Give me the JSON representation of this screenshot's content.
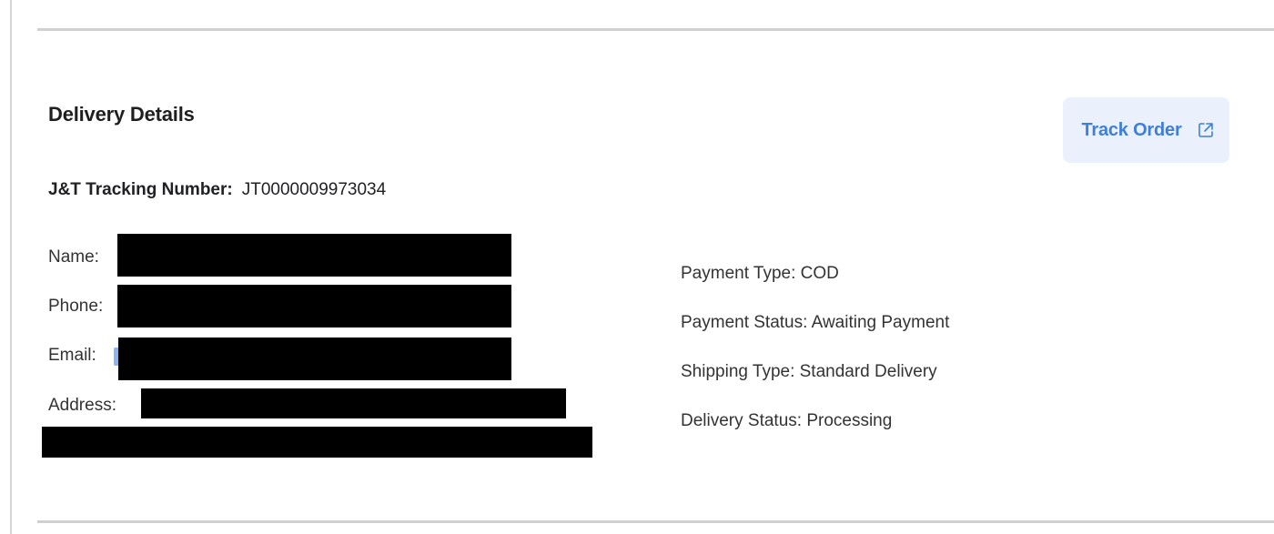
{
  "section": {
    "title": "Delivery Details",
    "track_button": {
      "label": "Track Order",
      "icon": "external-link-icon",
      "color": "#3f7fd9",
      "background": "#eaf1fc"
    },
    "tracking": {
      "label": "J&T Tracking Number:",
      "value": "JT0000009973034"
    },
    "customer": {
      "name_label": "Name:",
      "phone_label": "Phone:",
      "email_label": "Email:",
      "address_label": "Address:"
    },
    "order_info": {
      "payment_type": "Payment Type: COD",
      "payment_status": "Payment Status: Awaiting Payment",
      "shipping_type": "Shipping Type: Standard Delivery",
      "delivery_status": "Delivery Status: Processing"
    }
  }
}
